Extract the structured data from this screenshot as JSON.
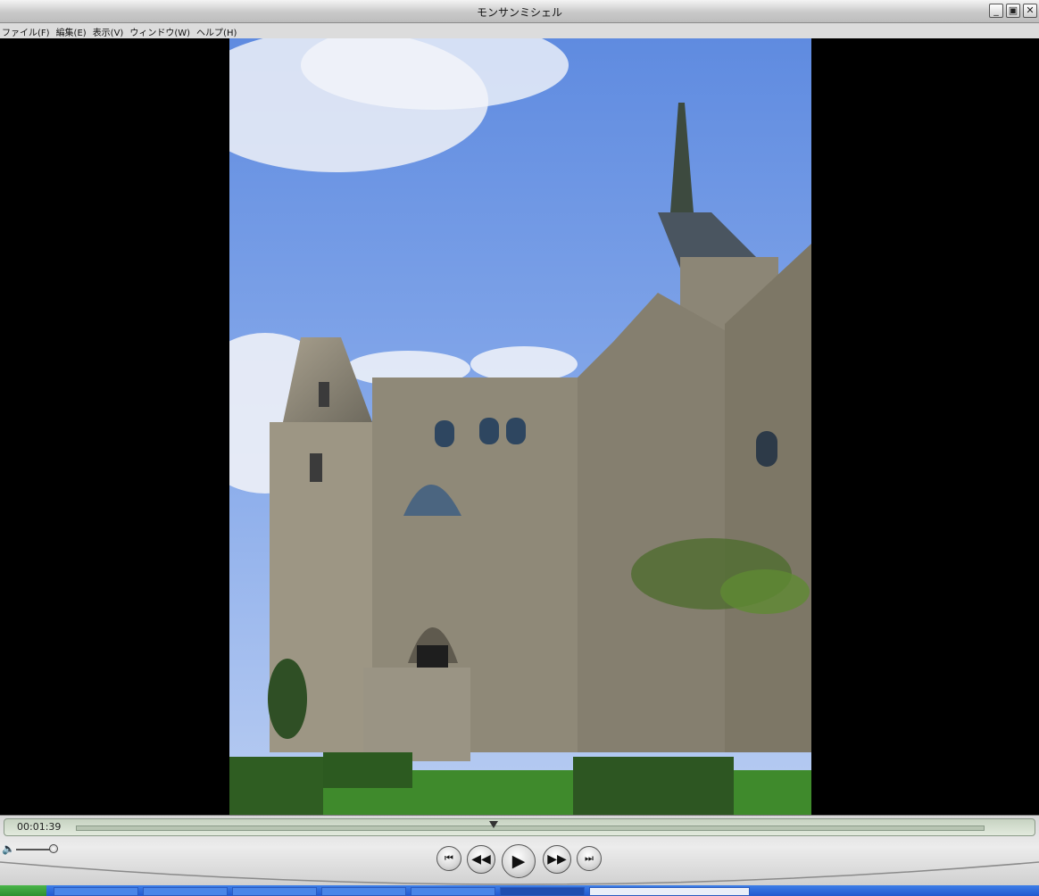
{
  "window": {
    "title": "モンサンミシェル",
    "buttons": {
      "minimize": "_",
      "restore": "▣",
      "close": "✕"
    }
  },
  "menu": [
    {
      "label": "ファイル(F)"
    },
    {
      "label": "編集(E)"
    },
    {
      "label": "表示(V)"
    },
    {
      "label": "ウィンドウ(W)"
    },
    {
      "label": "ヘルプ(H)"
    }
  ],
  "video": {
    "content": "photo-of-mont-saint-michel-abbey",
    "sky_color": "#6d96e0",
    "stone_color": "#8b8474",
    "grass_color": "#3f8a2c"
  },
  "playback": {
    "time": "00:01:39",
    "progress_fraction": 0.46,
    "volume_fraction": 1.0
  },
  "controls": {
    "prev_icon": "⏮",
    "rewind_icon": "◀◀",
    "play_icon": "▶",
    "forward_icon": "▶▶",
    "next_icon": "⏭",
    "volume_icon": "🔈"
  }
}
